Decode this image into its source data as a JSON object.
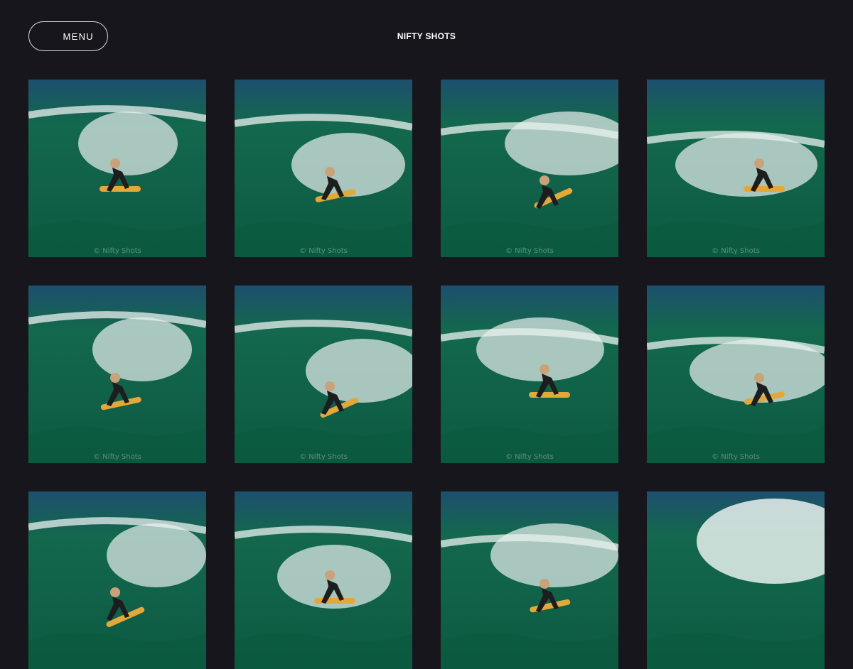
{
  "header": {
    "menu_label": "MENU",
    "site_title": "NIFTY SHOTS"
  },
  "gallery": {
    "watermark": "© Nifty Shots",
    "photos": [
      {
        "subject": "surfer-carving",
        "shown_watermark": true
      },
      {
        "subject": "surfer-aerial-turn",
        "shown_watermark": true
      },
      {
        "subject": "surfer-crouching-on-wave",
        "shown_watermark": true
      },
      {
        "subject": "surfer-carving",
        "shown_watermark": true
      },
      {
        "subject": "surfer-spray-turn",
        "shown_watermark": true
      },
      {
        "subject": "surfer-aerial-turn",
        "shown_watermark": true
      },
      {
        "subject": "surfer-crouching-on-wave",
        "shown_watermark": true
      },
      {
        "subject": "surfer-crouching-on-wave",
        "shown_watermark": true
      },
      {
        "subject": "surfer-crouching-on-wave",
        "shown_watermark": false
      },
      {
        "subject": "surfer-crouching-on-wave",
        "shown_watermark": false
      },
      {
        "subject": "surfer-crouching-on-wave",
        "shown_watermark": false
      },
      {
        "subject": "breaking-wave",
        "shown_watermark": false
      }
    ]
  },
  "colors": {
    "background": "#17161c",
    "wave_green": "#0e6b4a",
    "sky_blue": "#1d4f6e",
    "spray_white": "#e9f1ef",
    "surfboard_yellow": "#e3a83a",
    "wetsuit_black": "#1c1d1f"
  }
}
